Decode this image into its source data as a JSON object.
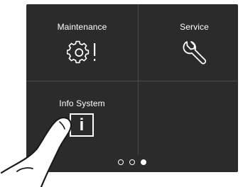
{
  "tiles": [
    {
      "label": "Maintenance",
      "icon": "gear-alert-icon"
    },
    {
      "label": "Service",
      "icon": "wrench-icon"
    },
    {
      "label": "Info System",
      "icon": "info-icon"
    },
    {
      "label": "",
      "icon": ""
    }
  ],
  "info_icon_glyph": "i",
  "pager": {
    "pages": 3,
    "active_page": 3
  },
  "colors": {
    "panel": "#2b2b2b",
    "divider": "#4a4a4a",
    "foreground": "#ffffff"
  }
}
